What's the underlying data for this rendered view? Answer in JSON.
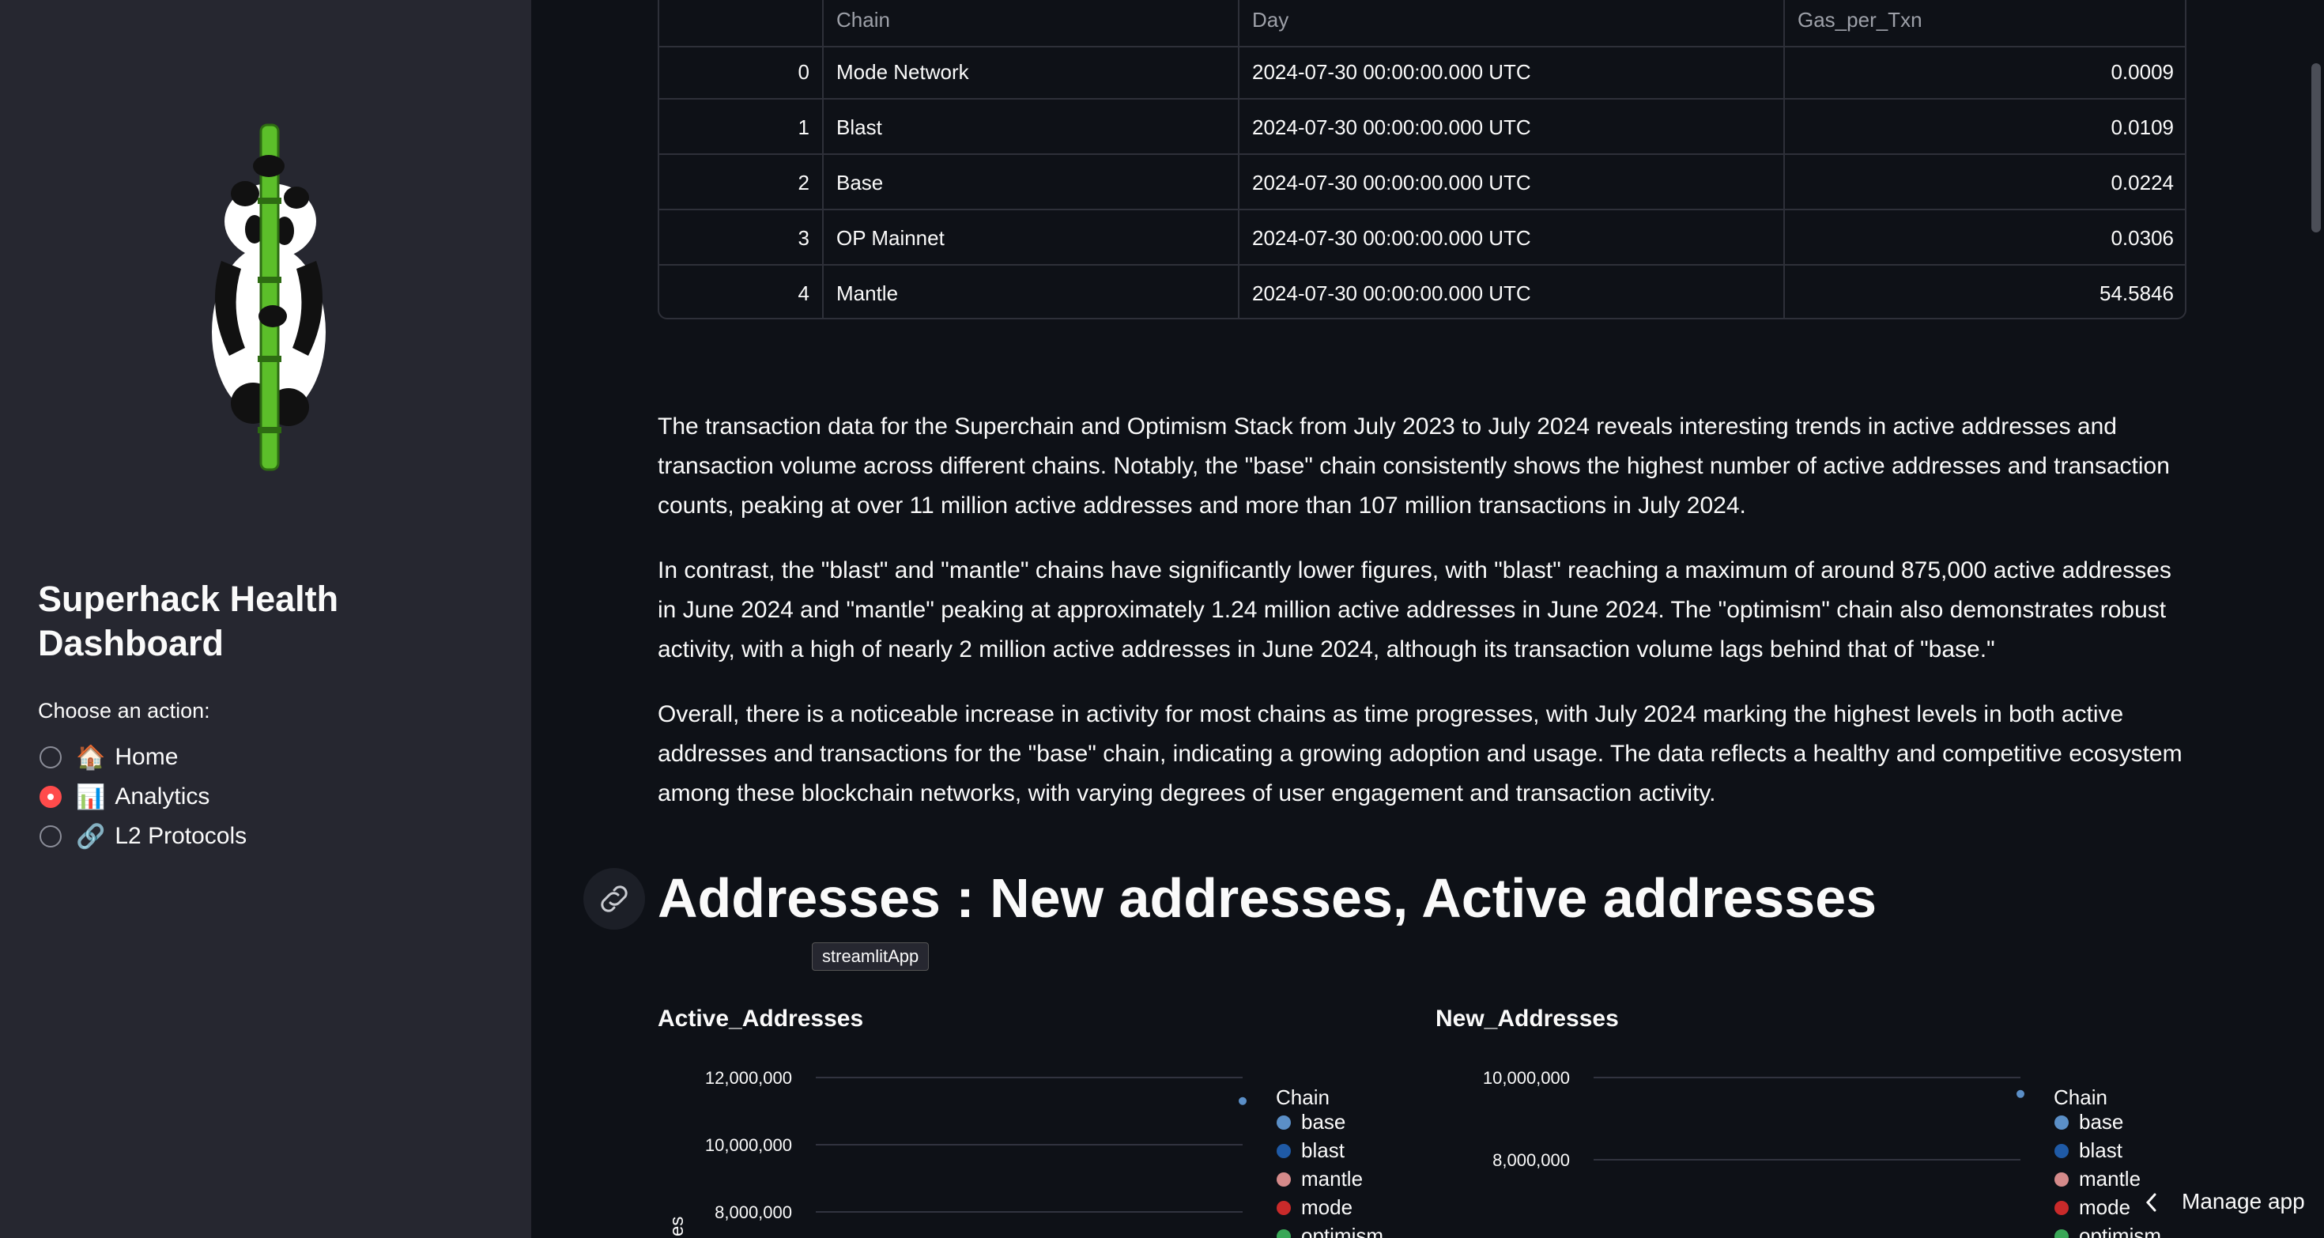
{
  "sidebar": {
    "title": "Superhack Health Dashboard",
    "action_label": "Choose an action:",
    "options": [
      {
        "icon": "🏠",
        "label": "Home",
        "selected": false
      },
      {
        "icon": "📊",
        "label": "Analytics",
        "selected": true
      },
      {
        "icon": "🔗",
        "label": "L2 Protocols",
        "selected": false
      }
    ]
  },
  "table": {
    "columns": [
      "",
      "Chain",
      "Day",
      "Gas_per_Txn"
    ],
    "rows": [
      [
        "0",
        "Mode Network",
        "2024-07-30 00:00:00.000 UTC",
        "0.0009"
      ],
      [
        "1",
        "Blast",
        "2024-07-30 00:00:00.000 UTC",
        "0.0109"
      ],
      [
        "2",
        "Base",
        "2024-07-30 00:00:00.000 UTC",
        "0.0224"
      ],
      [
        "3",
        "OP Mainnet",
        "2024-07-30 00:00:00.000 UTC",
        "0.0306"
      ],
      [
        "4",
        "Mantle",
        "2024-07-30 00:00:00.000 UTC",
        "54.5846"
      ]
    ]
  },
  "paragraphs": [
    "The transaction data for the Superchain and Optimism Stack from July 2023 to July 2024 reveals interesting trends in active addresses and transaction volume across different chains. Notably, the \"base\" chain consistently shows the highest number of active addresses and transaction counts, peaking at over 11 million active addresses and more than 107 million transactions in July 2024.",
    "In contrast, the \"blast\" and \"mantle\" chains have significantly lower figures, with \"blast\" reaching a maximum of around 875,000 active addresses in June 2024 and \"mantle\" peaking at approximately 1.24 million active addresses in June 2024. The \"optimism\" chain also demonstrates robust activity, with a high of nearly 2 million active addresses in June 2024, although its transaction volume lags behind that of \"base.\"",
    "Overall, there is a noticeable increase in activity for most chains as time progresses, with July 2024 marking the highest levels in both active addresses and transactions for the \"base\" chain, indicating a growing adoption and usage. The data reflects a healthy and competitive ecosystem among these blockchain networks, with varying degrees of user engagement and transaction activity."
  ],
  "section_heading": "Addresses : New addresses, Active addresses",
  "tooltip": "streamlitApp",
  "manage_app_label": "Manage app",
  "colors": {
    "base": "#5b8fc7",
    "blast": "#1f5aa6",
    "mantle": "#d48a8a",
    "mode": "#c92a2a",
    "accent": "#ff4b4b"
  },
  "chart_data": [
    {
      "type": "scatter",
      "title": "Active_Addresses",
      "ylabel": "es",
      "y_ticks": [
        "12,000,000",
        "10,000,000",
        "8,000,000"
      ],
      "legend_title": "Chain",
      "legend": [
        "base",
        "blast",
        "mantle",
        "mode",
        "optimism"
      ],
      "series": [
        {
          "name": "base",
          "values": [
            11300000
          ]
        }
      ]
    },
    {
      "type": "scatter",
      "title": "New_Addresses",
      "y_ticks": [
        "10,000,000",
        "8,000,000"
      ],
      "legend_title": "Chain",
      "legend": [
        "base",
        "blast",
        "mantle",
        "mode",
        "optimism"
      ],
      "series": [
        {
          "name": "base",
          "values": [
            9600000
          ]
        }
      ]
    }
  ]
}
